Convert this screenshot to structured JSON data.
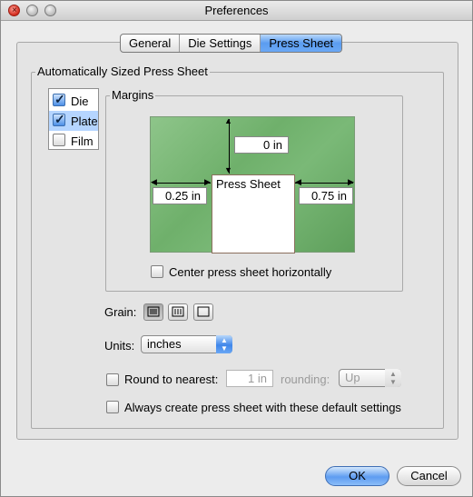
{
  "window": {
    "title": "Preferences"
  },
  "tabs": [
    {
      "label": "General",
      "active": false
    },
    {
      "label": "Die Settings",
      "active": false
    },
    {
      "label": "Press Sheet",
      "active": true
    }
  ],
  "auto_sized": {
    "group_label": "Automatically Sized Press Sheet",
    "list_items": [
      {
        "label": "Die",
        "checked": true,
        "selected": false
      },
      {
        "label": "Plate",
        "checked": true,
        "selected": true
      },
      {
        "label": "Film",
        "checked": false,
        "selected": false
      }
    ]
  },
  "margins": {
    "group_label": "Margins",
    "top_value": "0 in",
    "left_value": "0.25 in",
    "right_value": "0.75 in",
    "sheet_label": "Press Sheet",
    "center_checkbox_label": "Center press sheet horizontally",
    "center_checked": false
  },
  "grain": {
    "label": "Grain:",
    "options": [
      "horizontal-grain-icon",
      "vertical-grain-icon",
      "no-grain-icon"
    ],
    "selected": 0
  },
  "units": {
    "label": "Units:",
    "value": "inches"
  },
  "round": {
    "label": "Round to nearest:",
    "value": "1 in",
    "rounding_label": "rounding:",
    "rounding_value": "Up",
    "checked": false
  },
  "always_create": {
    "label": "Always create press sheet with these default settings",
    "checked": false
  },
  "buttons": {
    "ok": "OK",
    "cancel": "Cancel"
  },
  "colors": {
    "accent": "#5b9cf0",
    "diagram_green": "#7ab977"
  }
}
